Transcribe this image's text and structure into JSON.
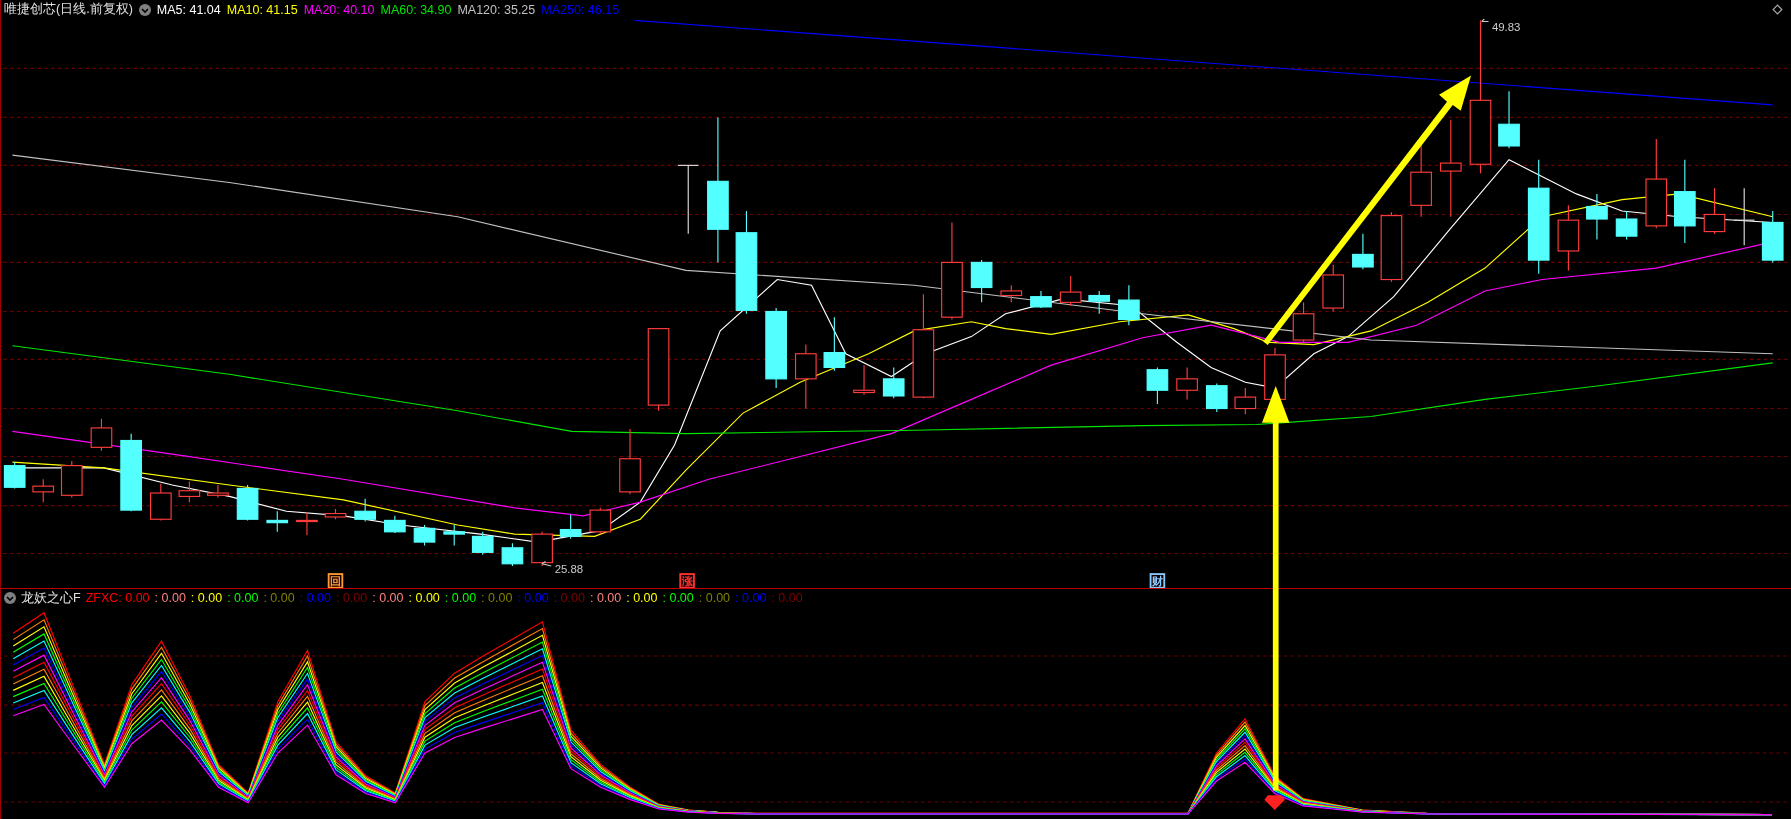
{
  "header": {
    "title": "唯捷创芯(日线.前复权)",
    "ma": [
      {
        "label": "MA5: 41.04",
        "color": "#ffffff"
      },
      {
        "label": "MA10: 41.15",
        "color": "#ffff00"
      },
      {
        "label": "MA20: 40.10",
        "color": "#ff00ff"
      },
      {
        "label": "MA60: 34.90",
        "color": "#00e600"
      },
      {
        "label": "MA120: 35.25",
        "color": "#c0c0c0"
      },
      {
        "label": "MA250: 46.15",
        "color": "#0000ff"
      }
    ]
  },
  "chart": {
    "high_label": "49.83",
    "low_label": "25.88",
    "markers": [
      {
        "text": "回",
        "color": "#ff9933"
      },
      {
        "text": "涨",
        "color": "#ff3333"
      },
      {
        "text": "财",
        "color": "#88ccff"
      }
    ]
  },
  "indicator": {
    "name": "龙妖之心F",
    "values": [
      {
        "text": "ZFXC: 0.00",
        "color": "#ff0000"
      },
      {
        "text": ": 0.00",
        "color": "#ff8080"
      },
      {
        "text": ": 0.00",
        "color": "#ffff00"
      },
      {
        "text": ": 0.00",
        "color": "#00ff00"
      },
      {
        "text": ": 0.00",
        "color": "#808000"
      },
      {
        "text": ": 0.00",
        "color": "#0000ff"
      },
      {
        "text": ": 0.00",
        "color": "#800000"
      },
      {
        "text": ": 0.00",
        "color": "#ff8080"
      },
      {
        "text": ": 0.00",
        "color": "#ffff00"
      },
      {
        "text": ": 0.00",
        "color": "#00ff00"
      },
      {
        "text": ": 0.00",
        "color": "#808000"
      },
      {
        "text": ": 0.00",
        "color": "#0000ff"
      },
      {
        "text": ": 0.00",
        "color": "#800000"
      },
      {
        "text": ": 0.00",
        "color": "#ff8080"
      },
      {
        "text": ": 0.00",
        "color": "#ffff00"
      },
      {
        "text": ": 0.00",
        "color": "#00ff00"
      },
      {
        "text": ": 0.00",
        "color": "#808000"
      },
      {
        "text": ": 0.00",
        "color": "#0000ff"
      },
      {
        "text": ": 0.00",
        "color": "#800000"
      }
    ]
  }
}
